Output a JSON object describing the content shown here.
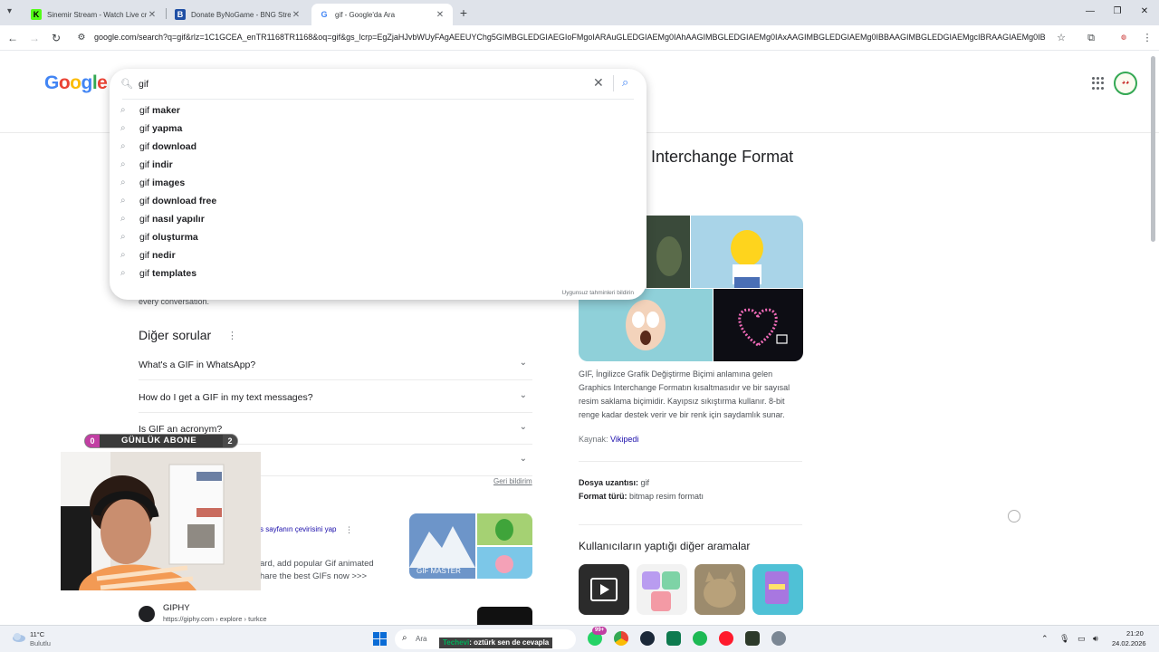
{
  "browser": {
    "tabs": [
      {
        "title": "Sinemir Stream - Watch Live cr",
        "favicon": "kick-icon",
        "active": false
      },
      {
        "title": "Donate ByNoGame - BNG Strea",
        "favicon": "bynogame-icon",
        "active": false
      },
      {
        "title": "gif - Google'da Ara",
        "favicon": "google-icon",
        "active": true
      }
    ],
    "url": "google.com/search?q=gif&rlz=1C1GCEA_enTR1168TR1168&oq=gif&gs_lcrp=EgZjaHJvbWUyFAgAEEUYChg5GIMBGLEDGIAEGIoFMgoIARAuGLEDGIAEMg0IAhAAGIMBGLEDGIAEMg0IAxAAGIMBGLEDGIAEMg0IBBAAGIMBGLEDGIAEMgcIBRAAGIAEMg0IBhB..."
  },
  "search": {
    "query": "gif",
    "suggestions": [
      {
        "prefix": "gif",
        "bold": "maker"
      },
      {
        "prefix": "gif",
        "bold": "yapma"
      },
      {
        "prefix": "gif",
        "bold": "download"
      },
      {
        "prefix": "gif",
        "bold": "indir"
      },
      {
        "prefix": "gif",
        "bold": "images"
      },
      {
        "prefix": "gif",
        "bold": "download free"
      },
      {
        "prefix": "gif",
        "bold": "nasıl yapılır"
      },
      {
        "prefix": "gif",
        "bold": "oluşturma"
      },
      {
        "prefix": "gif",
        "bold": "nedir"
      },
      {
        "prefix": "gif",
        "bold": "templates"
      }
    ],
    "report_link": "Uygunsuz tahminleri bildirin"
  },
  "knowledge_panel": {
    "title_partial": "Interchange Format",
    "description": "GIF, İngilizce Grafik Değiştirme Biçimi anlamına gelen Graphics Interchange Formatın kısaltmasıdır ve bir sayısal resim saklama biçimidir. Kayıpsız sıkıştırma kullanır. 8-bit renge kadar destek verir ve bir renk için saydamlık sunar.",
    "source_label": "Kaynak:",
    "source_link": "Vikipedi",
    "facts": [
      {
        "label": "Dosya uzantısı:",
        "value": "gif"
      },
      {
        "label": "Format türü:",
        "value": "bitmap resim formatı"
      }
    ],
    "others_title": "Kullanıcıların yaptığı diğer aramalar"
  },
  "main": {
    "fade_text": "every conversation.",
    "other_questions_title": "Diğer sorular",
    "faqs": [
      "What's a GIF in WhatsApp?",
      "How do I get a GIF in my text messages?",
      "Is GIF an acronym?",
      ""
    ],
    "feedback": "Geri bildirim",
    "result1": {
      "translate": "s sayfanın çevirisini yap",
      "snippet1": "ard, add popular Gif animated",
      "snippet2": "hare the best GIFs now >>>",
      "thumb_caption": "GIF MASTER"
    },
    "result2": {
      "name": "GIPHY",
      "url": "https://giphy.com › explore › turkce"
    }
  },
  "overlay": {
    "sub_left": "0",
    "sub_label": "GÜNLÜK ABONE",
    "sub_right": "2",
    "caption_name": "Techevi",
    "caption_text": ": oztürk sen de cevapla"
  },
  "taskbar": {
    "weather_temp": "11°C",
    "weather_cond": "Bulutlu",
    "search_placeholder": "Ara",
    "badge": "99+",
    "time": "21:20",
    "date": "24.02.2026"
  },
  "colors": {
    "link": "#1a0dab",
    "accent_blue": "#4285f4",
    "sub_pink": "#c13fa3"
  }
}
